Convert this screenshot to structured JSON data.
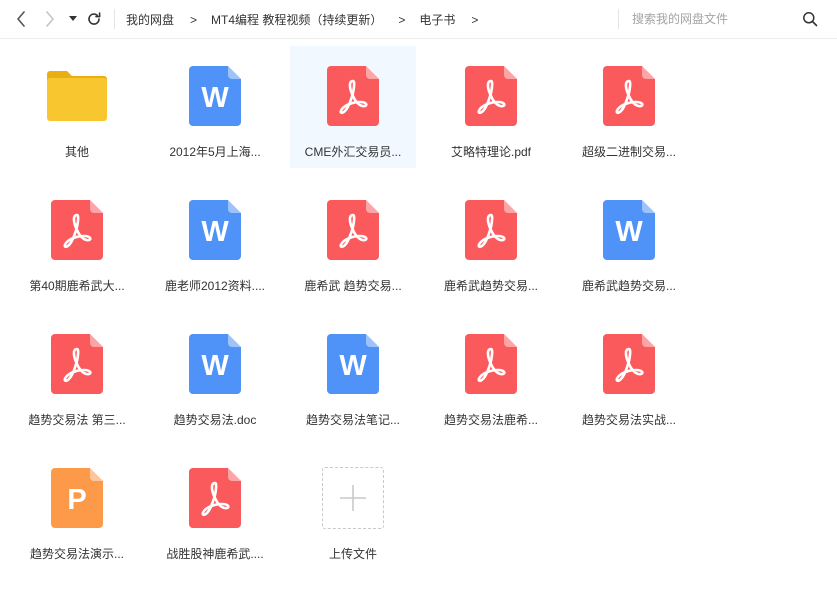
{
  "toolbar": {
    "breadcrumb": [
      "我的网盘",
      "MT4编程 教程视频（持续更新）",
      "电子书"
    ],
    "separator": ">",
    "search_placeholder": "搜索我的网盘文件"
  },
  "files": [
    {
      "name": "其他",
      "type": "folder"
    },
    {
      "name": "2012年5月上海...",
      "type": "word"
    },
    {
      "name": "CME外汇交易员...",
      "type": "pdf",
      "selected": true
    },
    {
      "name": "艾略特理论.pdf",
      "type": "pdf"
    },
    {
      "name": "超级二进制交易...",
      "type": "pdf"
    },
    {
      "name": "第40期鹿希武大...",
      "type": "pdf"
    },
    {
      "name": "鹿老师2012资料....",
      "type": "word"
    },
    {
      "name": "鹿希武 趋势交易...",
      "type": "pdf"
    },
    {
      "name": "鹿希武趋势交易...",
      "type": "pdf"
    },
    {
      "name": "鹿希武趋势交易...",
      "type": "word"
    },
    {
      "name": "趋势交易法 第三...",
      "type": "pdf"
    },
    {
      "name": "趋势交易法.doc",
      "type": "word"
    },
    {
      "name": "趋势交易法笔记...",
      "type": "word"
    },
    {
      "name": "趋势交易法鹿希...",
      "type": "pdf"
    },
    {
      "name": "趋势交易法实战...",
      "type": "pdf"
    },
    {
      "name": "趋势交易法演示...",
      "type": "ppt"
    },
    {
      "name": "战胜股神鹿希武....",
      "type": "pdf"
    }
  ],
  "upload": {
    "label": "上传文件"
  },
  "colors": {
    "pdf": "#fb5a5d",
    "word": "#4f93f8",
    "ppt": "#fd9a4a",
    "folder": "#f8c62e",
    "selected_bg": "#f1f8ff"
  },
  "icons": {
    "back": "chevron-left-icon",
    "forward": "chevron-right-icon",
    "dropdown": "caret-down-icon",
    "refresh": "refresh-icon",
    "search": "search-icon"
  }
}
